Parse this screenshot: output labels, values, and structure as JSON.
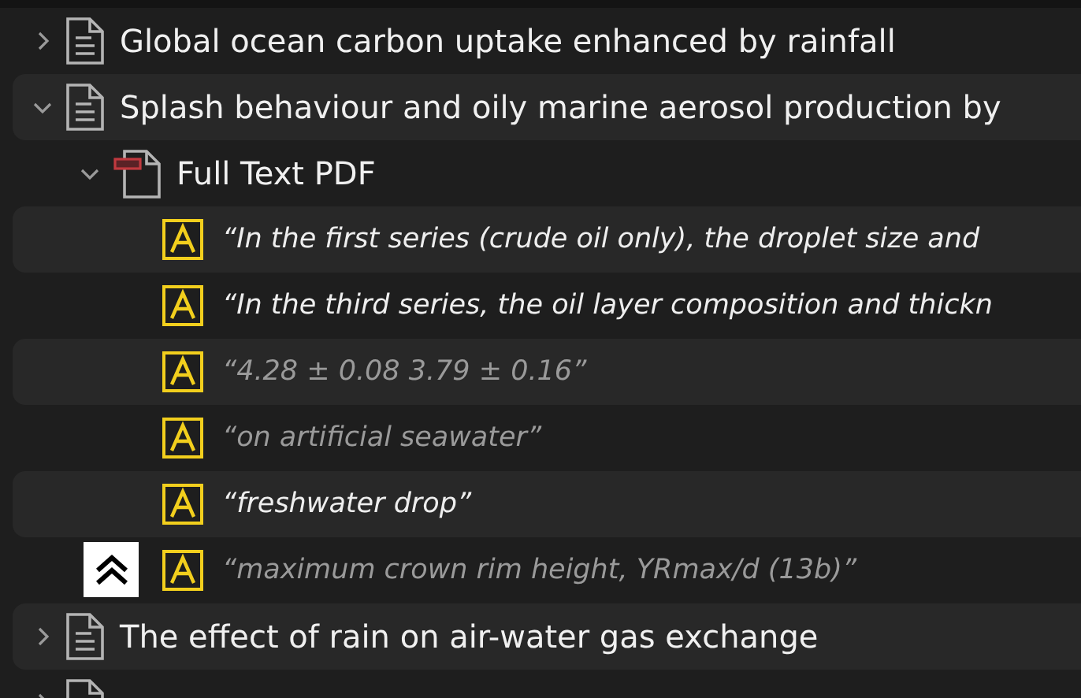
{
  "items": [
    {
      "kind": "document",
      "title": "Global ocean carbon uptake enhanced by rainfall",
      "expanded": false
    },
    {
      "kind": "document",
      "title": "Splash behaviour and oily marine aerosol production by",
      "expanded": true,
      "children": [
        {
          "kind": "pdf",
          "title": "Full Text PDF",
          "expanded": true,
          "children": [
            {
              "kind": "annotation",
              "title": "“In the first series (crude oil only), the droplet size and",
              "dimmed": false,
              "jump_button": false
            },
            {
              "kind": "annotation",
              "title": "“In the third series, the oil layer composition and thickn",
              "dimmed": false,
              "jump_button": false
            },
            {
              "kind": "annotation",
              "title": "“4.28 ± 0.08 3.79 ± 0.16”",
              "dimmed": true,
              "jump_button": false
            },
            {
              "kind": "annotation",
              "title": "“on artificial seawater”",
              "dimmed": true,
              "jump_button": false
            },
            {
              "kind": "annotation",
              "title": "“freshwater drop”",
              "dimmed": false,
              "jump_button": false
            },
            {
              "kind": "annotation",
              "title": "“maximum crown rim height, YRmax/d (13b)”",
              "dimmed": true,
              "jump_button": true
            }
          ]
        }
      ]
    },
    {
      "kind": "document",
      "title": "The effect of rain on air-water gas exchange",
      "expanded": false
    },
    {
      "kind": "document",
      "expanded": false
    }
  ]
}
